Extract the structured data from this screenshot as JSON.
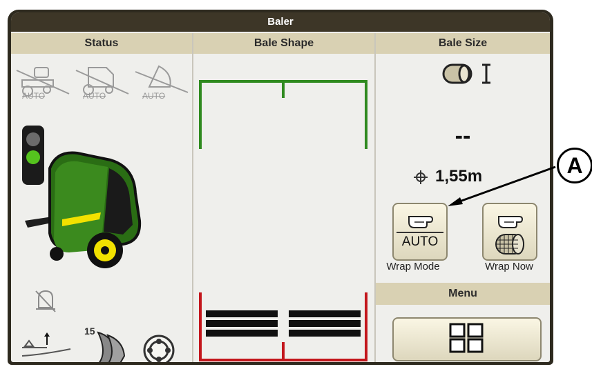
{
  "window": {
    "title": "Baler"
  },
  "columns": {
    "status": "Status",
    "bale_shape": "Bale Shape",
    "bale_size": "Bale Size"
  },
  "status_panel": {
    "auto_labels": [
      "AUTO",
      "AUTO",
      "AUTO"
    ],
    "knife_count": "15"
  },
  "bale_size_panel": {
    "current_size": "--",
    "target_diameter": "1,55m",
    "wrap_mode_button": {
      "badge": "AUTO",
      "label": "Wrap Mode"
    },
    "wrap_now_button": {
      "label": "Wrap Now"
    }
  },
  "menu": {
    "header": "Menu"
  },
  "callout": {
    "label": "A"
  },
  "colors": {
    "frame": "#2e2a1f",
    "title_bar": "#3d3627",
    "header_bg": "#d9d1b3",
    "shape_green": "#2f8a1f",
    "shape_red": "#c3161c",
    "deere_green": "#3b8a1e",
    "deere_yellow": "#f2e100"
  }
}
